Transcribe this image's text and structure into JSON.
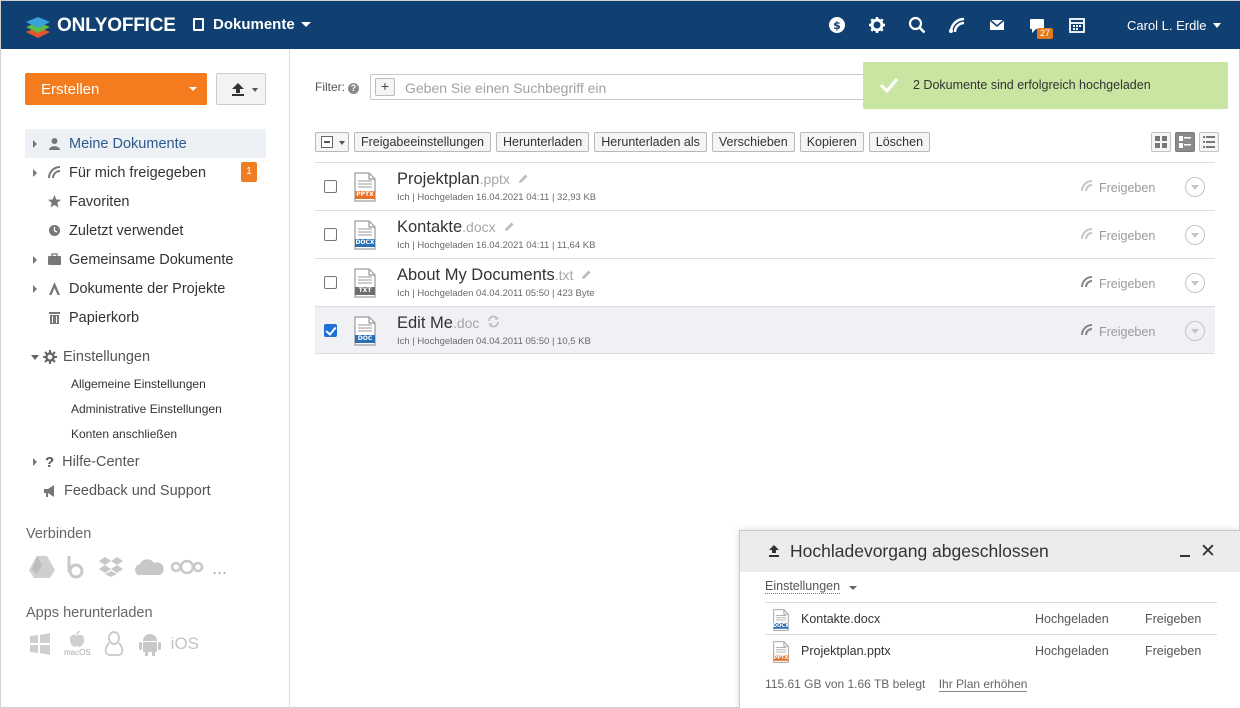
{
  "topbar": {
    "logo_text": "ONLYOFFICE",
    "module_label": "Dokumente",
    "chat_badge": "27",
    "user_name": "Carol L. Erdle",
    "icons": [
      "dollar-icon",
      "gear-icon",
      "search-icon",
      "feed-icon",
      "mail-icon",
      "chat-icon",
      "calendar-icon"
    ]
  },
  "sidebar": {
    "create_label": "Erstellen",
    "nav": [
      {
        "label": "Meine Dokumente",
        "icon": "user-icon",
        "expandable": true,
        "active": true
      },
      {
        "label": "Für mich freigegeben",
        "icon": "share-icon",
        "expandable": true,
        "count": "1"
      },
      {
        "label": "Favoriten",
        "icon": "star-icon",
        "expandable": false
      },
      {
        "label": "Zuletzt verwendet",
        "icon": "clock-icon",
        "expandable": false
      },
      {
        "label": "Gemeinsame Dokumente",
        "icon": "briefcase-icon",
        "expandable": true
      },
      {
        "label": "Dokumente der Projekte",
        "icon": "compass-icon",
        "expandable": true
      },
      {
        "label": "Papierkorb",
        "icon": "trash-icon",
        "expandable": false
      }
    ],
    "settings_label": "Einstellungen",
    "settings_items": [
      "Allgemeine Einstellungen",
      "Administrative Einstellungen",
      "Konten anschließen"
    ],
    "help_label": "Hilfe-Center",
    "feedback_label": "Feedback und Support",
    "connect_title": "Verbinden",
    "connect_more": "...",
    "apps_title": "Apps herunterladen",
    "apps_macos": "macOS",
    "apps_ios": "iOS"
  },
  "filter": {
    "label": "Filter:",
    "plus": "+",
    "placeholder": "Geben Sie einen Suchbegriff ein"
  },
  "toast": {
    "message": "2 Dokumente sind erfolgreich hochgeladen"
  },
  "toolbar": {
    "buttons": [
      "Freigabeeinstellungen",
      "Herunterladen",
      "Herunterladen als",
      "Verschieben",
      "Kopieren",
      "Löschen"
    ]
  },
  "files": [
    {
      "name": "Projektplan",
      "ext": ".pptx",
      "badge": "PPTX",
      "badge_color": "#e8712a",
      "meta": "Ich | Hochgeladen 16.04.2021 04:11 | 32,93 KB",
      "share": "Freigeben",
      "selected": false,
      "action": "edit"
    },
    {
      "name": "Kontakte",
      "ext": ".docx",
      "badge": "DOCX",
      "badge_color": "#2a6fb5",
      "meta": "Ich | Hochgeladen 16.04.2021 04:11 | 11,64 KB",
      "share": "Freigeben",
      "selected": false,
      "action": "edit"
    },
    {
      "name": "About My Documents",
      "ext": ".txt",
      "badge": "TXT",
      "badge_color": "#6e6e6e",
      "meta": "Ich | Hochgeladen 04.04.2011 05:50 | 423 Byte",
      "share": "Freigeben",
      "selected": false,
      "action": "edit"
    },
    {
      "name": "Edit Me",
      "ext": ".doc",
      "badge": "DOC",
      "badge_color": "#2a6fb5",
      "meta": "Ich | Hochgeladen 04.04.2011 05:50 | 10,5 KB",
      "share": "Freigeben",
      "selected": true,
      "action": "convert"
    }
  ],
  "upload_panel": {
    "title": "Hochladevorgang abgeschlossen",
    "close_symbol": "✕",
    "settings_label": "Einstellungen",
    "rows": [
      {
        "name": "Kontakte.docx",
        "badge": "DOCX",
        "badge_color": "#2a6fb5",
        "status": "Hochgeladen",
        "share": "Freigeben"
      },
      {
        "name": "Projektplan.pptx",
        "badge": "PPTX",
        "badge_color": "#e8712a",
        "status": "Hochgeladen",
        "share": "Freigeben"
      }
    ],
    "quota": "115.61 GB von 1.66 TB belegt",
    "upgrade_link": "Ihr Plan erhöhen"
  }
}
